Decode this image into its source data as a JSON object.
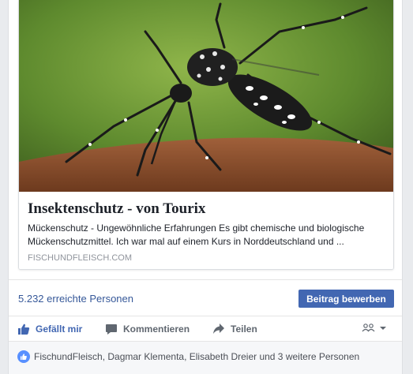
{
  "post": {
    "link_preview": {
      "image_icon": "mosquito-photo",
      "title": "Insektenschutz - von Tourix",
      "description": "Mückenschutz - Ungewöhnliche Erfahrungen Es gibt chemische und biologische Mückenschutzmittel. Ich war mal auf einem Kurs in Norddeutschland und ...",
      "domain": "FISCHUNDFLEISCH.COM"
    },
    "stats": {
      "reach": "5.232 erreichte Personen",
      "boost_label": "Beitrag bewerben"
    },
    "actions": {
      "like_label": "Gefällt mir",
      "comment_label": "Kommentieren",
      "share_label": "Teilen",
      "audience_icon": "friends-icon"
    },
    "likes": {
      "text": "FischundFleisch, Dagmar Klementa, Elisabeth Dreier und 3 weitere Personen"
    }
  },
  "colors": {
    "accent": "#4267b2",
    "link": "#365899",
    "muted": "#90949c",
    "text": "#1d2129"
  }
}
